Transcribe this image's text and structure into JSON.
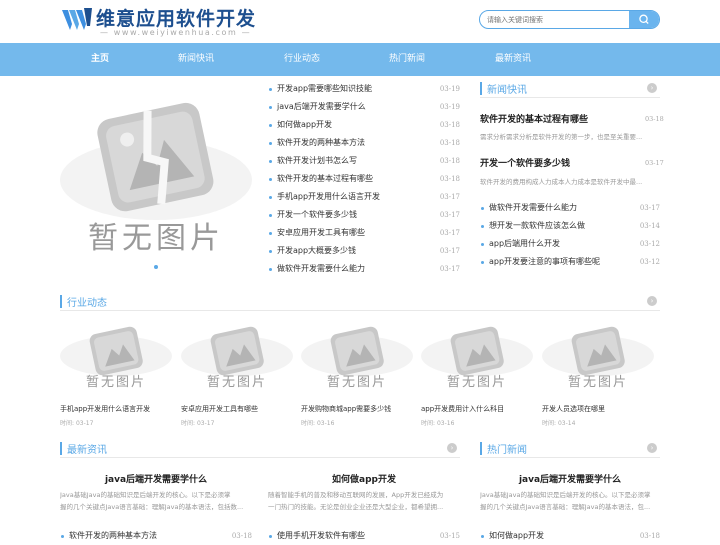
{
  "site": {
    "title": "维意应用软件开发",
    "subtitle": "www.weiyiwenhua.com"
  },
  "search": {
    "placeholder": "请输入关键词搜索"
  },
  "nav": [
    "主页",
    "新闻快讯",
    "行业动态",
    "热门新闻",
    "最新资讯"
  ],
  "banner": {
    "placeholder_text": "暂无图片"
  },
  "center_list": [
    {
      "title": "开发app需要哪些知识技能",
      "date": "03-19"
    },
    {
      "title": "java后端开发需要学什么",
      "date": "03-19"
    },
    {
      "title": "如何做app开发",
      "date": "03-18"
    },
    {
      "title": "软件开发的两种基本方法",
      "date": "03-18"
    },
    {
      "title": "软件开发计划书怎么写",
      "date": "03-18"
    },
    {
      "title": "软件开发的基本过程有哪些",
      "date": "03-18"
    },
    {
      "title": "手机app开发用什么语言开发",
      "date": "03-17"
    },
    {
      "title": "开发一个软件要多少钱",
      "date": "03-17"
    },
    {
      "title": "安卓应用开发工具有哪些",
      "date": "03-17"
    },
    {
      "title": "开发app大概要多少钱",
      "date": "03-17"
    },
    {
      "title": "做软件开发需要什么能力",
      "date": "03-17"
    }
  ],
  "news_flash": {
    "title": "新闻快讯",
    "features": [
      {
        "title": "软件开发的基本过程有哪些",
        "date": "03-18",
        "desc": "需求分析需求分析是软件开发的第一步，也是至关重要..."
      },
      {
        "title": "开发一个软件要多少钱",
        "date": "03-17",
        "desc": "软件开发的费用构成人力成本人力成本是软件开发中最..."
      }
    ],
    "list": [
      {
        "title": "做软件开发需要什么能力",
        "date": "03-17"
      },
      {
        "title": "想开发一款软件应该怎么做",
        "date": "03-14"
      },
      {
        "title": "app后端用什么开发",
        "date": "03-12"
      },
      {
        "title": "app开发要注意的事项有哪些呢",
        "date": "03-12"
      }
    ]
  },
  "industry": {
    "title": "行业动态",
    "time_label": "时间:",
    "cards": [
      {
        "title": "手机app开发用什么语言开发",
        "date": "03-17"
      },
      {
        "title": "安卓应用开发工具有哪些",
        "date": "03-17"
      },
      {
        "title": "开发购物商城app需要多少钱",
        "date": "03-16"
      },
      {
        "title": "app开发费用计入什么科目",
        "date": "03-16"
      },
      {
        "title": "开发人员选项在哪里",
        "date": "03-14"
      }
    ]
  },
  "latest": {
    "title": "最新资讯",
    "col1": {
      "head": "java后端开发需要学什么",
      "desc1": "Java基础Java的基础知识是后端开发的核心。以下是必须掌",
      "desc2": "握的几个关键点Java语言基础：理解Java的基本语法，包括数...",
      "item": {
        "title": "软件开发的两种基本方法",
        "date": "03-18"
      }
    },
    "col2": {
      "head": "如何做app开发",
      "desc1": "随着智能手机的普及和移动互联网的发展，App开发已经成为",
      "desc2": "一门热门的技能。无论是创业企业还是大型企业，都希望拥...",
      "item": {
        "title": "使用手机开发软件有哪些",
        "date": "03-15"
      }
    }
  },
  "hot": {
    "title": "热门新闻",
    "head": "java后端开发需要学什么",
    "desc1": "Java基础Java的基础知识是后端开发的核心。以下是必须掌",
    "desc2": "握的几个关键点Java语言基础：理解Java的基本语法，包...",
    "item": {
      "title": "如何做app开发",
      "date": "03-18"
    }
  },
  "colors": {
    "accent": "#5aa8e6",
    "nav_bg": "#74b9ec",
    "logo": "#1d4f8f"
  },
  "icons": {
    "search": "search-icon",
    "more": "arrow-right-icon"
  }
}
